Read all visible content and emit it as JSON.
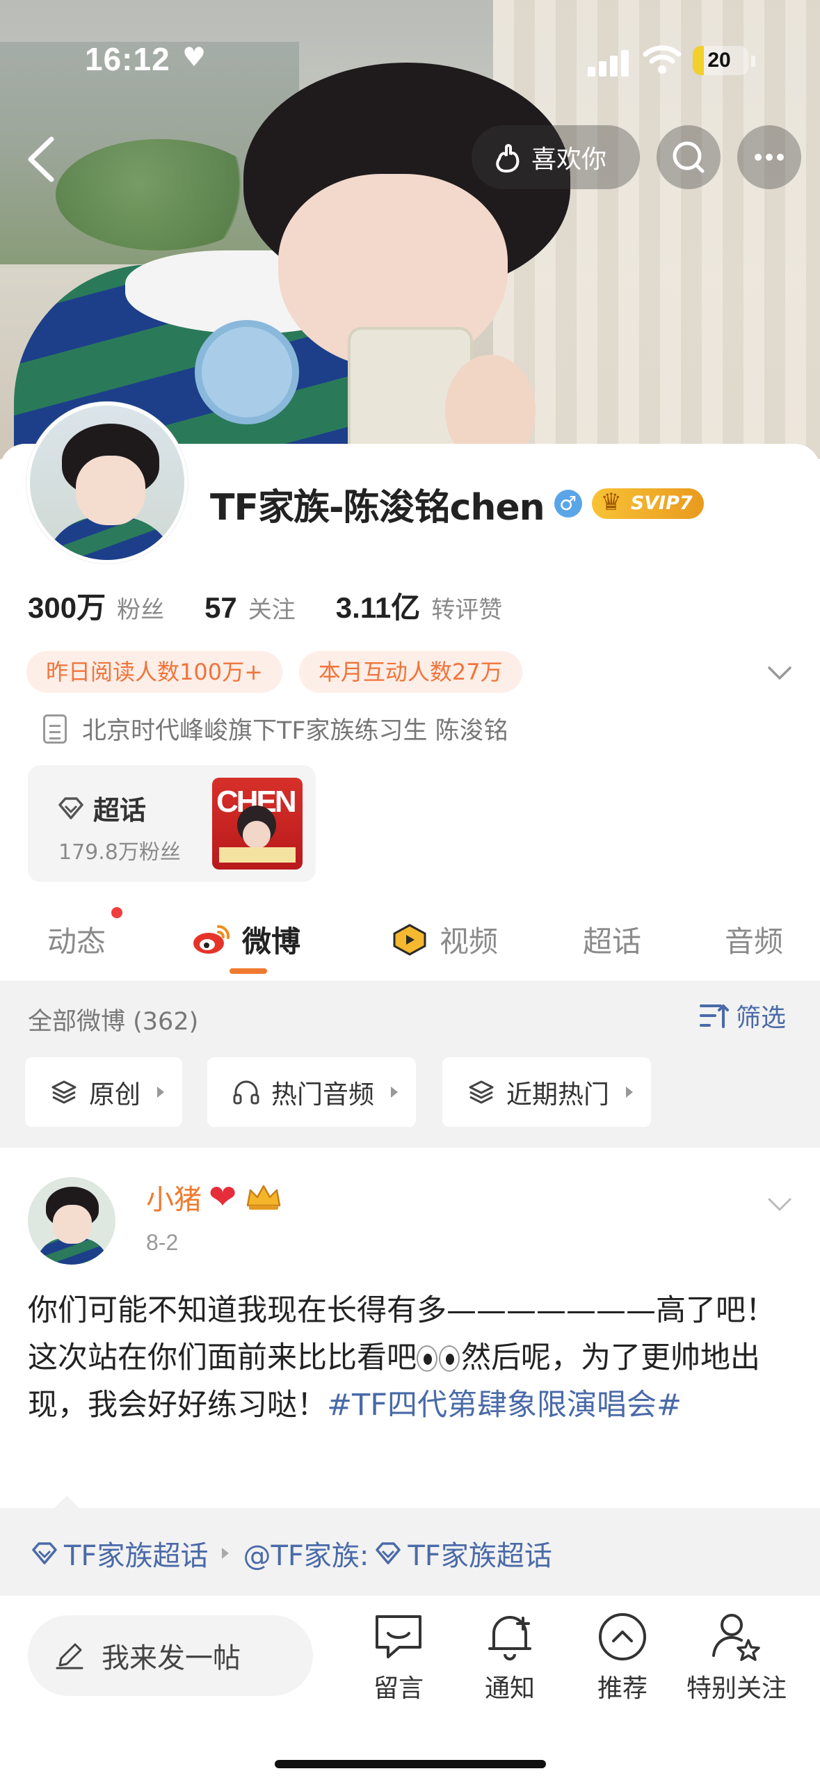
{
  "status_bar": {
    "time": "16:12",
    "battery": "20",
    "battery_level": 0.2,
    "icons": [
      "heart-icon",
      "signal-icon",
      "wifi-icon",
      "battery-icon"
    ]
  },
  "header": {
    "like_label": "喜欢你",
    "icons": [
      "back-arrow-icon",
      "gesture-icon",
      "search-icon",
      "more-icon"
    ]
  },
  "profile": {
    "username": "TF家族-陈浚铭chen",
    "gender_symbol": "♂",
    "svip_label": "SVIP7",
    "stats": [
      {
        "value": "300万",
        "label": "粉丝"
      },
      {
        "value": "57",
        "label": "关注"
      },
      {
        "value": "3.11亿",
        "label": "转评赞"
      }
    ],
    "tags": [
      "昨日阅读人数100万+",
      "本月互动人数27万"
    ],
    "bio": "北京时代峰峻旗下TF家族练习生  陈浚铭",
    "chaohua": {
      "title": "超话",
      "fans": "179.8万粉丝",
      "thumb_text": "CHEN"
    }
  },
  "tabs": [
    {
      "label": "动态",
      "active": false,
      "has_dot": true
    },
    {
      "label": "微博",
      "active": true,
      "has_dot": false
    },
    {
      "label": "视频",
      "active": false,
      "has_dot": false
    },
    {
      "label": "超话",
      "active": false,
      "has_dot": false
    },
    {
      "label": "音频",
      "active": false,
      "has_dot": false
    }
  ],
  "filter": {
    "title": "全部微博 (362)",
    "filter_label": "筛选",
    "chips": [
      "原创",
      "热门音频",
      "近期热门"
    ]
  },
  "post": {
    "user": "小猪",
    "date": "8-2",
    "text_before": "你们可能不知道我现在长得有多———————高了吧！这次站在你们面前来比比看吧",
    "text_after": "然后呢，为了更帅地出现，我会好好练习哒！",
    "hashtag": "#TF四代第肆象限演唱会#",
    "source": [
      "TF家族超话",
      "@TF家族:",
      "TF家族超话"
    ]
  },
  "bottom_bar": {
    "compose_placeholder": "我来发一帖",
    "actions": [
      "留言",
      "通知",
      "推荐",
      "特别关注"
    ]
  },
  "colors": {
    "accent_orange": "#f07a2f",
    "link_blue": "#4a6aa8",
    "tag_bg": "#fdeee7",
    "notification_red": "#f03d3d",
    "svip_gold": "#f8c236"
  }
}
